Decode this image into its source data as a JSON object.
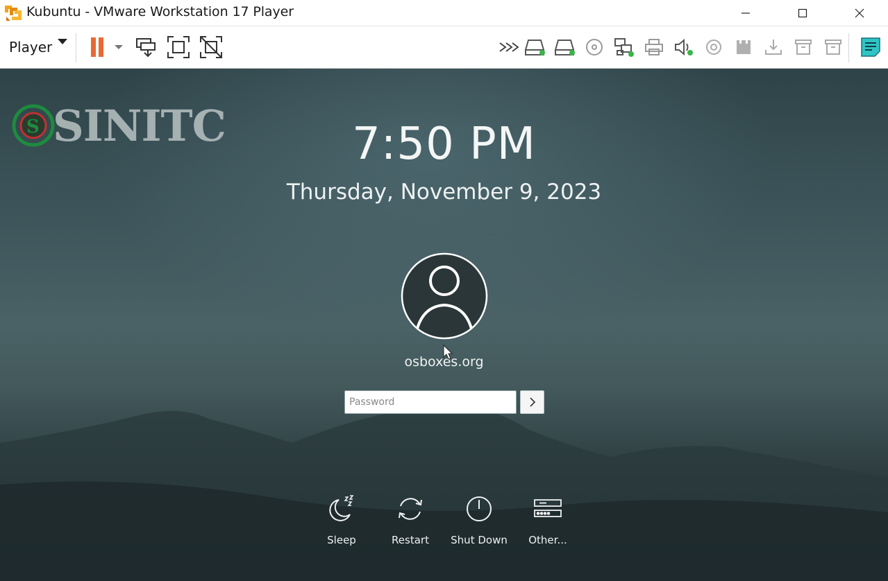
{
  "window": {
    "title": "Kubuntu - VMware Workstation 17 Player",
    "controls": [
      "minimize-icon",
      "maximize-icon",
      "close-icon"
    ]
  },
  "toolbar": {
    "player_menu_label": "Player",
    "left_icons": [
      "pause-icon",
      "send-ctrl-alt-del-icon",
      "fullscreen-icon",
      "unity-icon"
    ],
    "device_icons": [
      "more-devices-icon",
      "hard-disk-icon",
      "hard-disk-2-icon",
      "cd-dvd-icon",
      "network-adapter-icon",
      "printer-icon",
      "sound-card-icon",
      "floppy-icon",
      "usb-icon",
      "usb-download-icon",
      "archive-icon",
      "archive-2-icon",
      "message-log-icon"
    ],
    "accent_orange": "#e86a33",
    "status_green": "#39b54a"
  },
  "watermark": {
    "text": "SINITC"
  },
  "lock_screen": {
    "time": "7:50 PM",
    "date": "Thursday, November 9, 2023",
    "username": "osboxes.org",
    "password_placeholder": "Password",
    "actions": [
      {
        "label": "Sleep",
        "icon": "sleep-icon"
      },
      {
        "label": "Restart",
        "icon": "restart-icon"
      },
      {
        "label": "Shut Down",
        "icon": "power-icon"
      },
      {
        "label": "Other...",
        "icon": "other-sessions-icon"
      }
    ]
  }
}
